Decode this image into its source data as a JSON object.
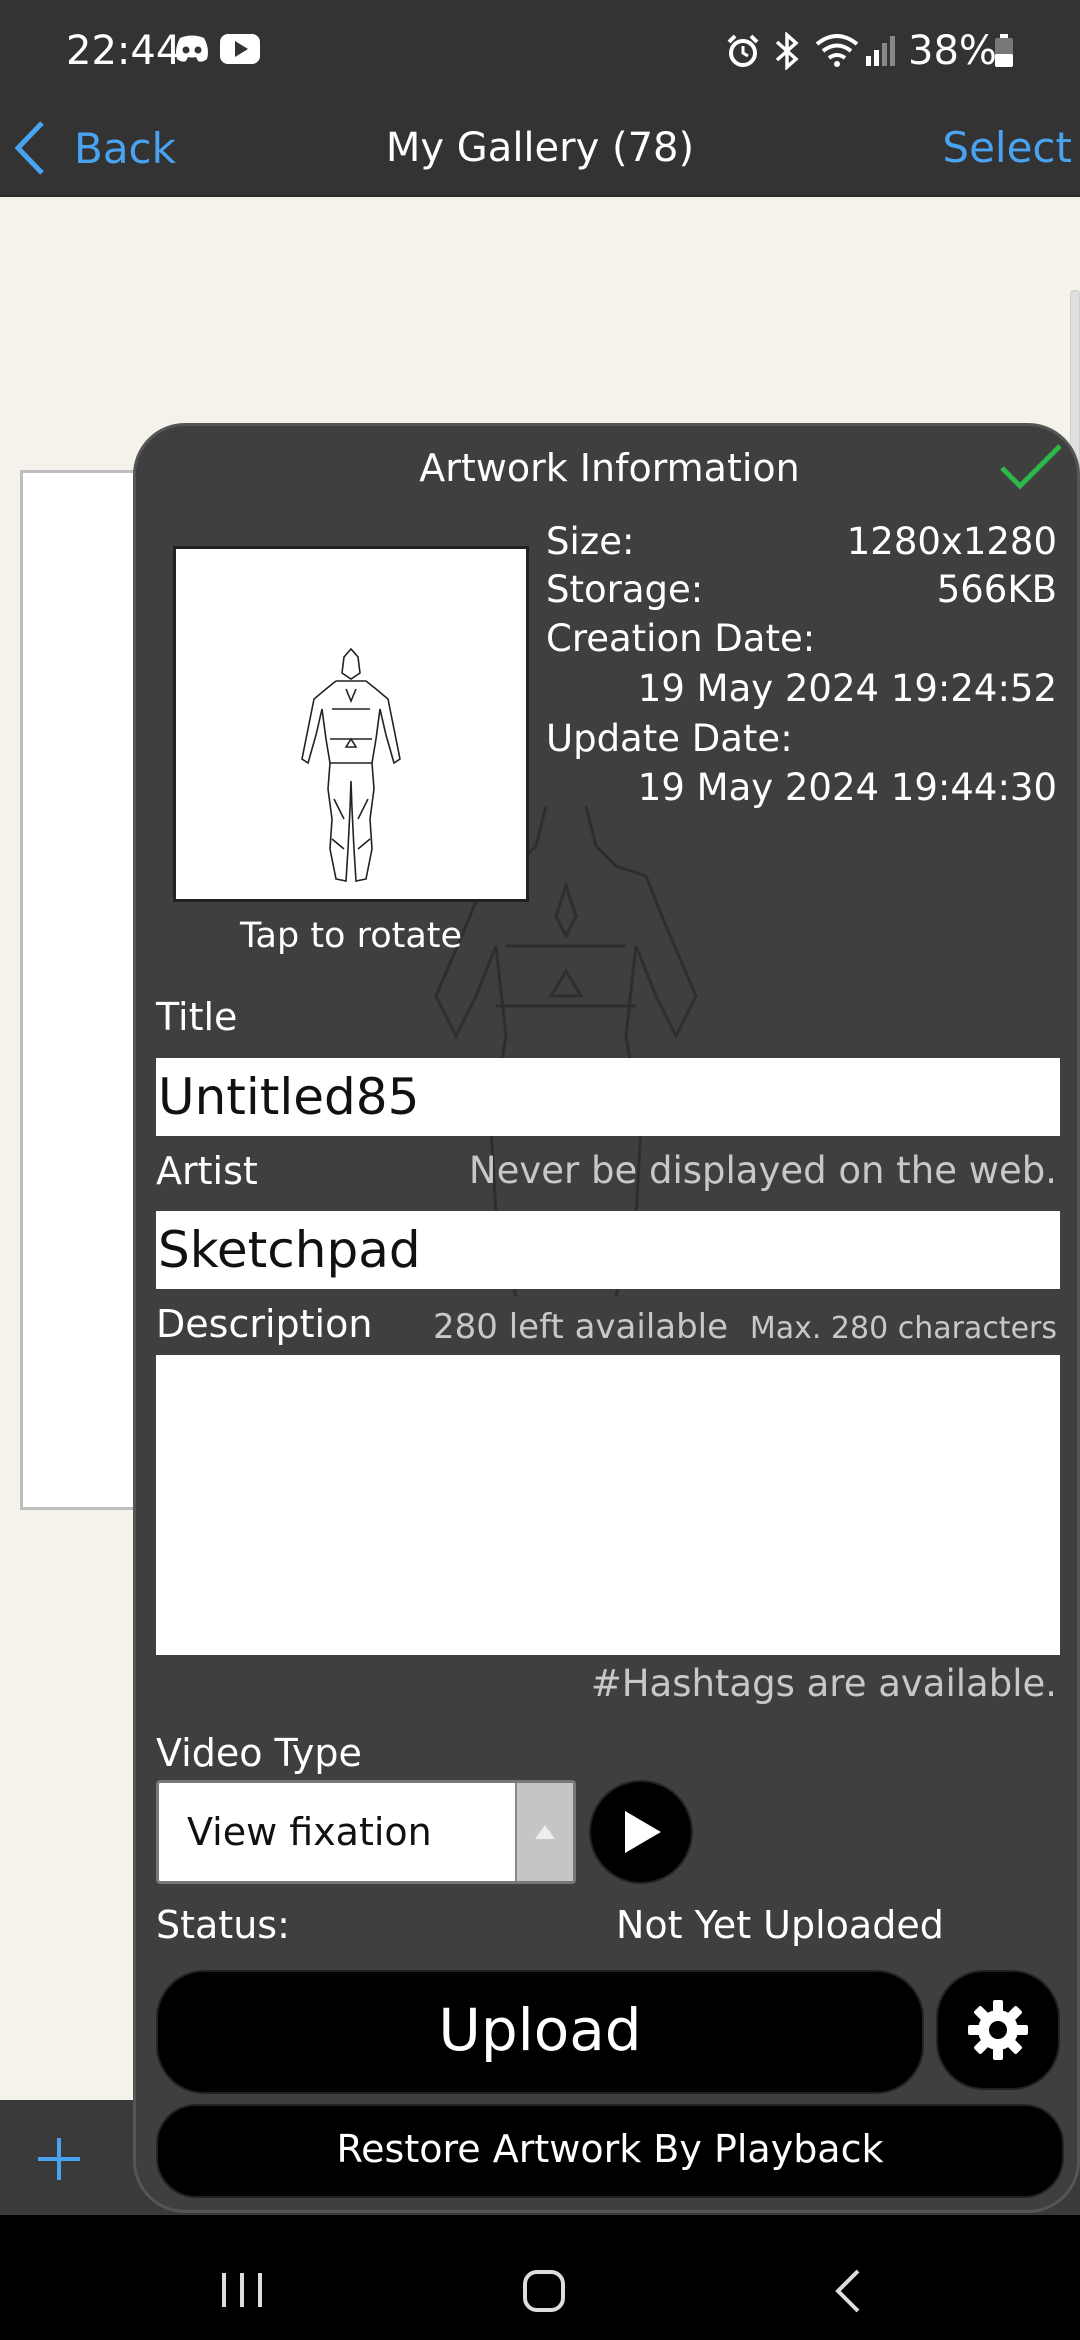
{
  "status_bar": {
    "time": "22:44",
    "battery": "38%",
    "icons": [
      "discord-icon",
      "youtube-icon",
      "alarm-icon",
      "bluetooth-icon",
      "wifi-icon",
      "signal-icon",
      "battery-icon"
    ]
  },
  "nav": {
    "back_label": "Back",
    "title": "My Gallery (78)",
    "select_label": "Select"
  },
  "panel": {
    "title": "Artwork Information",
    "confirm_icon": "check-icon",
    "thumbnail_caption": "Tap to rotate",
    "info": {
      "size_label": "Size:",
      "size_value": "1280x1280",
      "storage_label": "Storage:",
      "storage_value": "566KB",
      "creation_label": "Creation Date:",
      "creation_value": "19 May 2024 19:24:52",
      "update_label": "Update Date:",
      "update_value": "19 May 2024 19:44:30"
    },
    "title_label": "Title",
    "title_value": "Untitled85",
    "artist_label": "Artist",
    "artist_note": "Never be displayed on the web.",
    "artist_value": "Sketchpad",
    "description_label": "Description",
    "description_left": "280 left available",
    "description_max": "Max. 280 characters",
    "description_value": "",
    "hashtags_note": "#Hashtags are available.",
    "video_type_label": "Video Type",
    "video_type_value": "View fixation",
    "status_label": "Status:",
    "status_value": "Not Yet Uploaded",
    "upload_label": "Upload",
    "restore_label": "Restore Artwork By Playback"
  },
  "colors": {
    "accent": "#4aa3f0",
    "check": "#2fb84a",
    "panel_bg": "#3f3f3f",
    "bar_bg": "#333333"
  }
}
